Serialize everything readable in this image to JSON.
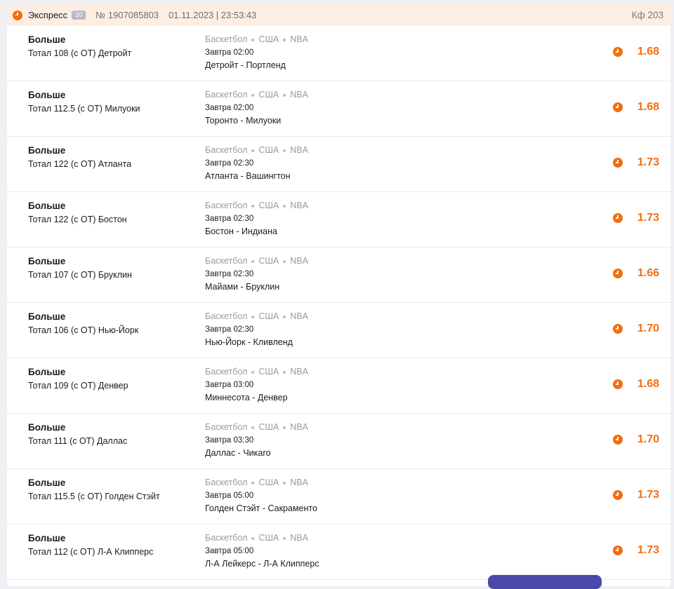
{
  "header": {
    "title": "Экспресс",
    "badge": "10",
    "number": "№ 1907085803",
    "datetime": "01.11.2023 | 23:53:43",
    "coef": "Кф 203"
  },
  "tournament": {
    "sport": "Баскетбол",
    "country": "США",
    "league": "NBA"
  },
  "colors": {
    "accent": "#f46d0f",
    "header_bg": "#fdeee4",
    "button": "#4b4aa8"
  },
  "bets": [
    {
      "market": "Больше",
      "selection": "Тотал 108 (с ОТ) Детройт",
      "time": "Завтра 02:00",
      "teams": "Детройт - Портленд",
      "odd": "1.68"
    },
    {
      "market": "Больше",
      "selection": "Тотал 112.5 (с ОТ) Милуоки",
      "time": "Завтра 02:00",
      "teams": "Торонто - Милуоки",
      "odd": "1.68"
    },
    {
      "market": "Больше",
      "selection": "Тотал 122 (с ОТ) Атланта",
      "time": "Завтра 02:30",
      "teams": "Атланта - Вашингтон",
      "odd": "1.73"
    },
    {
      "market": "Больше",
      "selection": "Тотал 122 (с ОТ) Бостон",
      "time": "Завтра 02:30",
      "teams": "Бостон - Индиана",
      "odd": "1.73"
    },
    {
      "market": "Больше",
      "selection": "Тотал 107 (с ОТ) Бруклин",
      "time": "Завтра 02:30",
      "teams": "Майами - Бруклин",
      "odd": "1.66"
    },
    {
      "market": "Больше",
      "selection": "Тотал 106 (с ОТ) Нью-Йорк",
      "time": "Завтра 02:30",
      "teams": "Нью-Йорк - Кливленд",
      "odd": "1.70"
    },
    {
      "market": "Больше",
      "selection": "Тотал 109 (с ОТ) Денвер",
      "time": "Завтра 03:00",
      "teams": "Миннесота - Денвер",
      "odd": "1.68"
    },
    {
      "market": "Больше",
      "selection": "Тотал 111 (с ОТ) Даллас",
      "time": "Завтра 03:30",
      "teams": "Даллас - Чикаго",
      "odd": "1.70"
    },
    {
      "market": "Больше",
      "selection": "Тотал 115.5 (с ОТ) Голден Стэйт",
      "time": "Завтра 05:00",
      "teams": "Голден Стэйт - Сакраменто",
      "odd": "1.73"
    },
    {
      "market": "Больше",
      "selection": "Тотал 112 (с ОТ) Л-А Клипперс",
      "time": "Завтра 05:00",
      "teams": "Л-А Лейкерс - Л-А Клипперс",
      "odd": "1.73"
    }
  ]
}
